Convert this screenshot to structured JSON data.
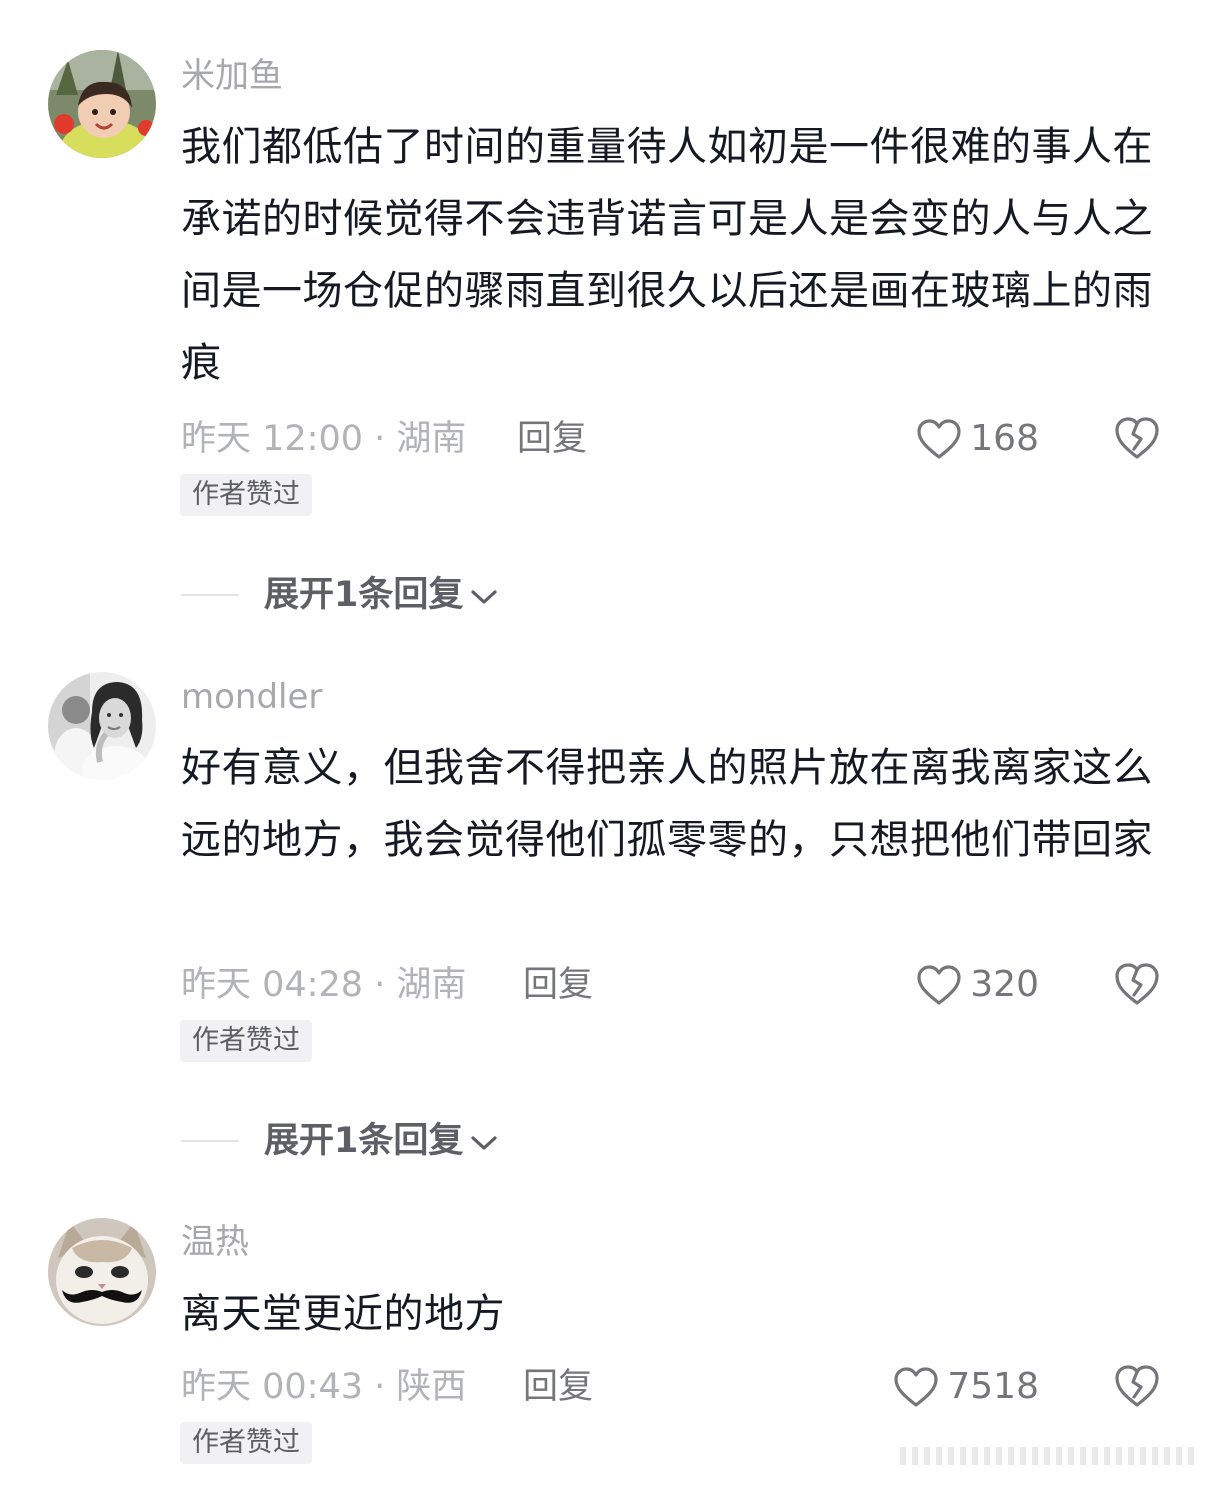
{
  "comments": [
    {
      "username": "米加鱼",
      "text": "我们都低估了时间的重量待人如初是一件很难的事人在承诺的时候觉得不会违背诺言可是人是会变的人与人之间是一场仓促的骤雨直到很久以后还是画在玻璃上的雨痕",
      "time_location": "昨天 12:00 · 湖南",
      "reply_label": "回复",
      "like_count": "168",
      "badge": "作者赞过",
      "expand_label": "展开1条回复",
      "avatar_icon": "child-photo-avatar"
    },
    {
      "username": "mondler",
      "text": "好有意义，但我舍不得把亲人的照片放在离我离家这么远的地方，我会觉得他们孤零零的，只想把他们带回家",
      "time_location": "昨天 04:28 · 湖南",
      "reply_label": "回复",
      "like_count": "320",
      "badge": "作者赞过",
      "expand_label": "展开1条回复",
      "avatar_icon": "bw-portrait-avatar"
    },
    {
      "username": "温热",
      "text": "离天堂更近的地方",
      "time_location": "昨天 00:43 · 陕西",
      "reply_label": "回复",
      "like_count": "7518",
      "badge": "作者赞过",
      "avatar_icon": "cat-mustache-avatar"
    }
  ],
  "icons": {
    "like": "heart-outline-icon",
    "dislike": "broken-heart-icon",
    "expand": "chevron-down-icon"
  },
  "colors": {
    "username": "#a7a8ad",
    "text": "#161823",
    "meta": "#b2b3b8",
    "action": "#75767c",
    "badge_bg": "#f1f1f3"
  }
}
